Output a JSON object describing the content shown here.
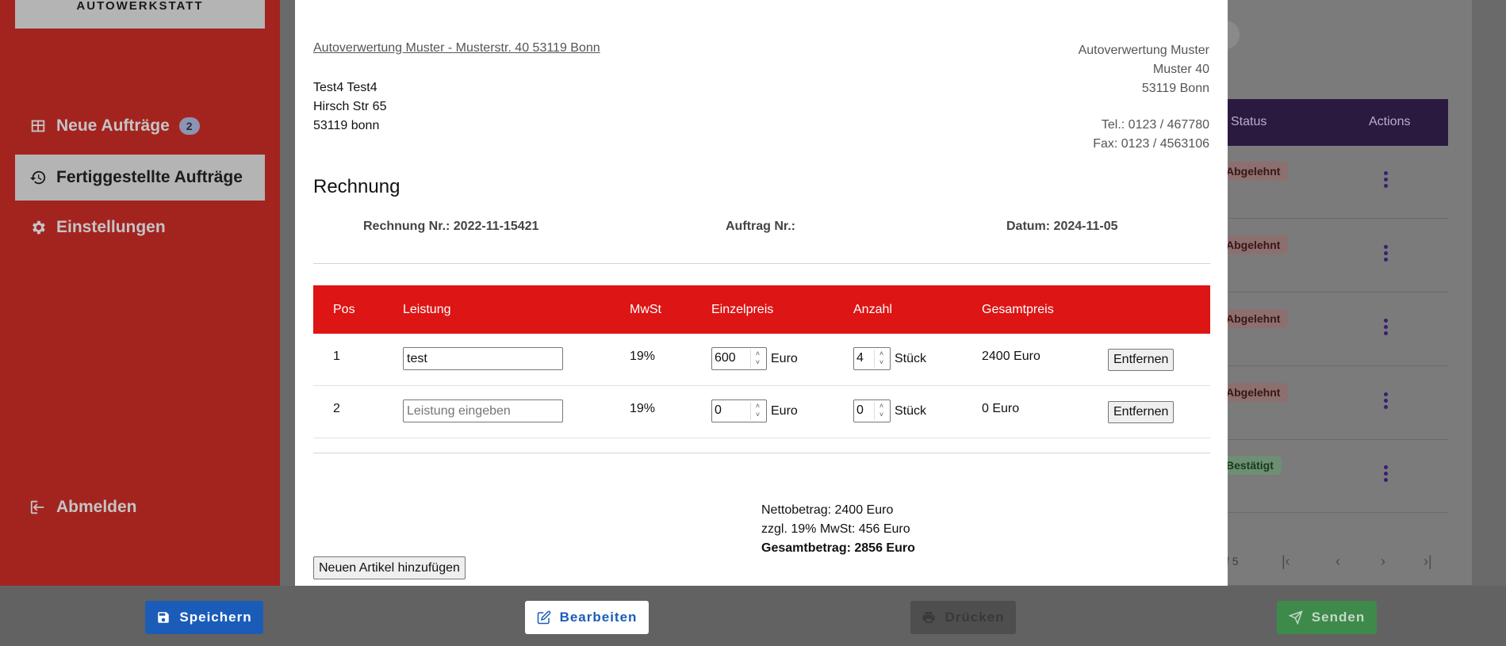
{
  "sidebar": {
    "brand": "AUTOWERKSTATT",
    "items": [
      {
        "label": "Neue Aufträge",
        "badge": "2",
        "icon": "table-icon"
      },
      {
        "label": "Fertiggestellte Aufträge",
        "icon": "history-icon"
      },
      {
        "label": "Einstellungen",
        "icon": "gear-icon"
      }
    ],
    "logout": {
      "label": "Abmelden",
      "icon": "logout-icon"
    }
  },
  "background_table": {
    "headers": {
      "status": "Status",
      "actions": "Actions"
    },
    "rows": [
      {
        "status": "Abgelehnt"
      },
      {
        "status": "Abgelehnt"
      },
      {
        "status": "Abgelehnt"
      },
      {
        "status": "Abgelehnt"
      },
      {
        "status": "Bestätigt"
      }
    ],
    "pager_text": "f 5"
  },
  "invoice": {
    "sender_line": "Autoverwertung Muster - Musterstr. 40 53119 Bonn",
    "recipient": [
      "Test4 Test4",
      "Hirsch Str 65",
      "53119 bonn"
    ],
    "company": [
      "Autoverwertung Muster",
      "Muster 40",
      "53119 Bonn"
    ],
    "contact": [
      "Tel.: 0123 / 467780",
      "Fax: 0123 / 4563106"
    ],
    "title": "Rechnung",
    "invoice_no": "Rechnung Nr.: 2022-11-15421",
    "order_no": "Auftrag Nr.:",
    "date": "Datum: 2024-11-05",
    "columns": {
      "pos": "Pos",
      "service": "Leistung",
      "vat": "MwSt",
      "unit_price": "Einzelpreis",
      "quantity": "Anzahl",
      "total": "Gesamtpreis"
    },
    "items": [
      {
        "pos": "1",
        "service": "test",
        "vat": "19%",
        "unit_price": "600",
        "currency": "Euro",
        "quantity": "4",
        "qty_unit": "Stück",
        "total": "2400 Euro",
        "remove": "Entfernen"
      },
      {
        "pos": "2",
        "service": "",
        "service_placeholder": "Leistung eingeben",
        "vat": "19%",
        "unit_price": "0",
        "currency": "Euro",
        "quantity": "0",
        "qty_unit": "Stück",
        "total": "0 Euro",
        "remove": "Entfernen"
      }
    ],
    "totals": {
      "net": "Nettobetrag: 2400 Euro",
      "vat": "zzgl. 19% MwSt: 456 Euro",
      "gross": "Gesamtbetrag: 2856 Euro"
    },
    "add_item": "Neuen Artikel hinzufügen"
  },
  "footer": {
    "save": "Speichern",
    "edit": "Bearbeiten",
    "print": "Drücken",
    "send": "Senden"
  },
  "colors": {
    "sidebar": "#a3241f",
    "table_header": "#dd1515",
    "save": "#1b5cb8",
    "send": "#3d8a4a"
  }
}
